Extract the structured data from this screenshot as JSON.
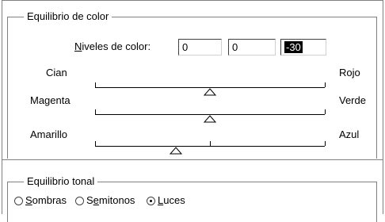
{
  "color_balance": {
    "legend": "Equilibrio de color",
    "levels_label_prefix": "N",
    "levels_label_rest": "iveles de color:",
    "level_values": [
      "0",
      "0",
      "-30"
    ],
    "sliders": [
      {
        "left": "Cian",
        "right": "Rojo",
        "value": 0
      },
      {
        "left": "Magenta",
        "right": "Verde",
        "value": 0
      },
      {
        "left": "Amarillo",
        "right": "Azul",
        "value": -30
      }
    ],
    "slider_range": [
      -100,
      100
    ]
  },
  "tonal_balance": {
    "legend": "Equilibrio tonal",
    "options": [
      {
        "key": "S",
        "rest": "ombras",
        "selected": false
      },
      {
        "key": "e",
        "prefix": "S",
        "rest": "mitonos",
        "selected": false
      },
      {
        "key": "L",
        "rest": "uces",
        "selected": true
      }
    ]
  }
}
